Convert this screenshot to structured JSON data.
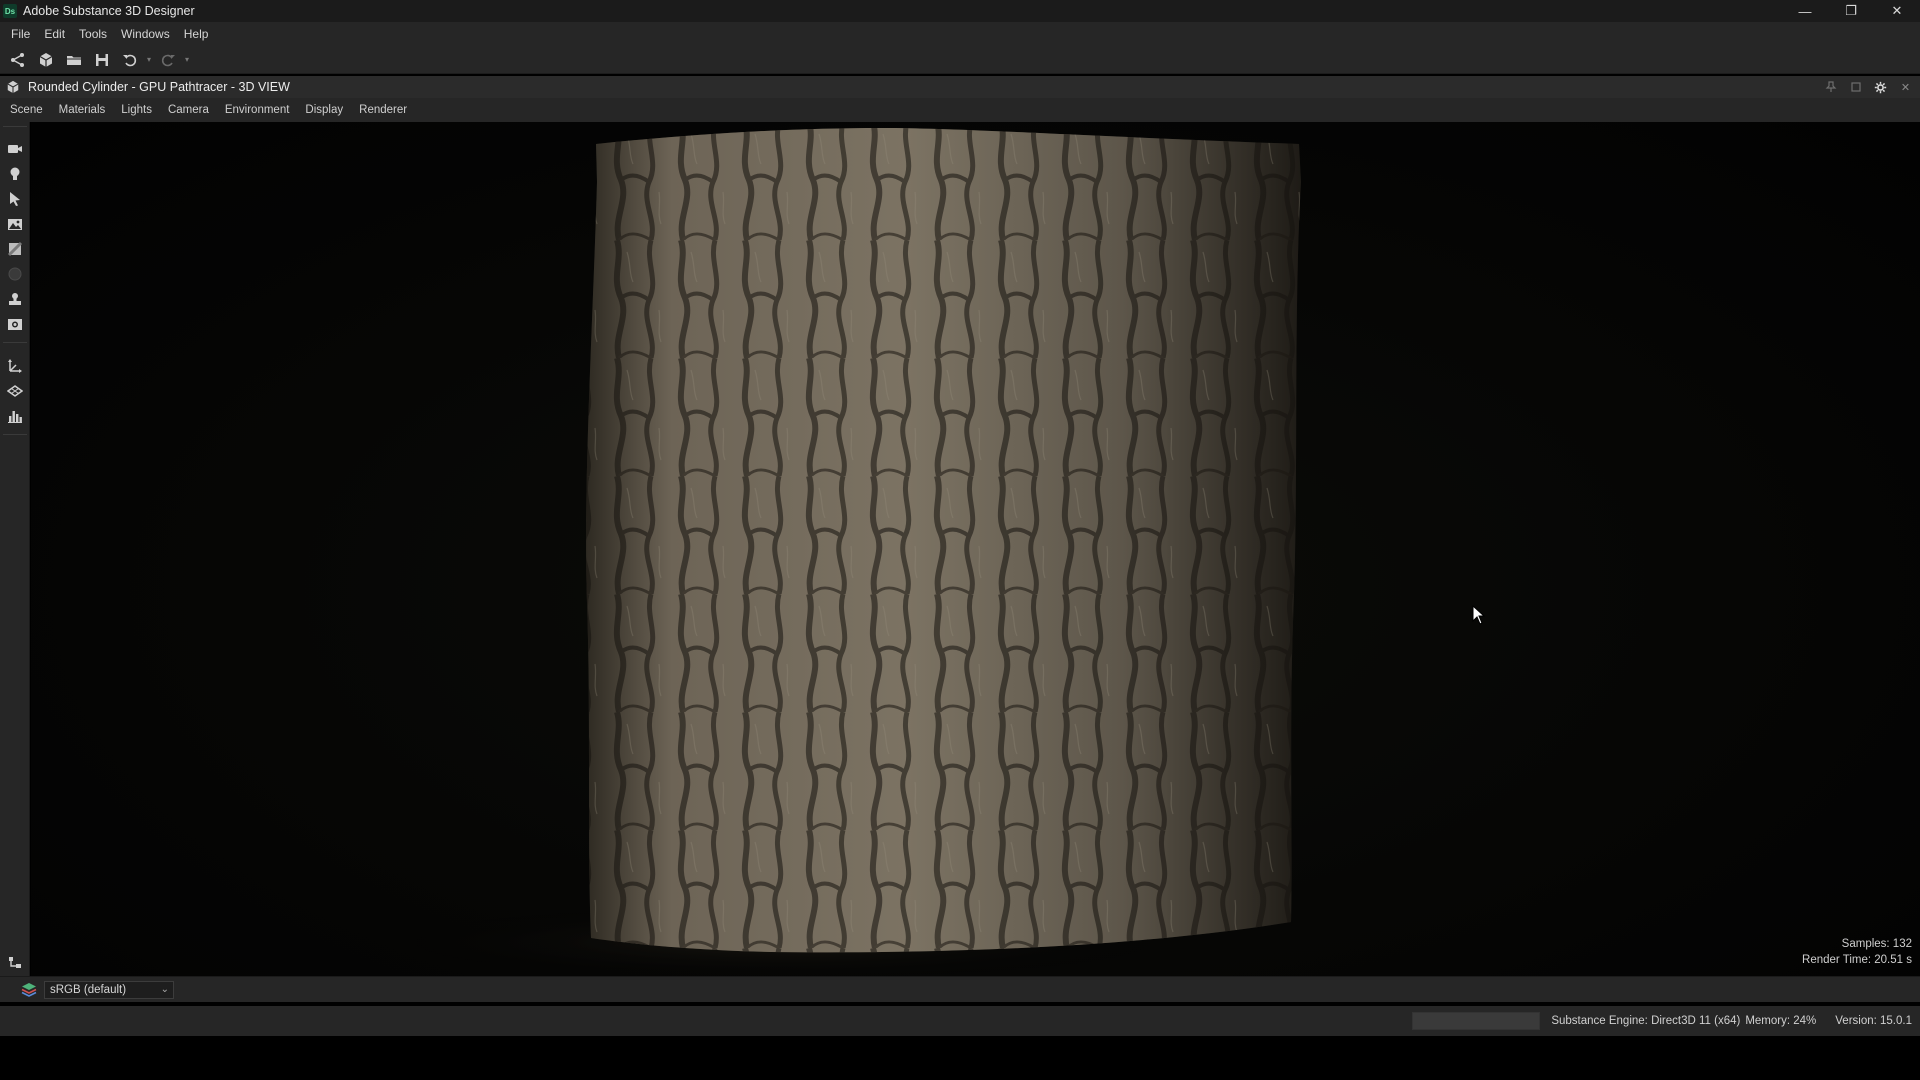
{
  "window": {
    "logo_text": "Ds",
    "title": "Adobe Substance 3D Designer",
    "controls": {
      "minimize": "—",
      "restore": "❐",
      "close": "✕"
    }
  },
  "menubar": {
    "items": [
      {
        "label": "File"
      },
      {
        "label": "Edit"
      },
      {
        "label": "Tools"
      },
      {
        "label": "Windows"
      },
      {
        "label": "Help"
      }
    ]
  },
  "toolbar": {
    "icons": [
      "graph-icon",
      "new-package-icon",
      "open-folder-icon",
      "save-icon",
      "undo-icon",
      "redo-icon"
    ]
  },
  "panel": {
    "title": "Rounded Cylinder - GPU Pathtracer - 3D VIEW"
  },
  "viewmenu": {
    "items": [
      {
        "label": "Scene"
      },
      {
        "label": "Materials"
      },
      {
        "label": "Lights"
      },
      {
        "label": "Camera"
      },
      {
        "label": "Environment"
      },
      {
        "label": "Display"
      },
      {
        "label": "Renderer"
      }
    ]
  },
  "viewport": {
    "samples": "Samples: 132",
    "render_time": "Render Time: 20.51 s"
  },
  "colorspace": {
    "selected": "sRGB (default)"
  },
  "status": {
    "engine": "Substance Engine: Direct3D 11 (x64)",
    "memory": "Memory: 24%",
    "version": "Version: 15.0.1"
  },
  "colors": {
    "accent": "#6fe3a9",
    "bark_dark": "#2a2620",
    "bark_light": "#8a7f70"
  }
}
